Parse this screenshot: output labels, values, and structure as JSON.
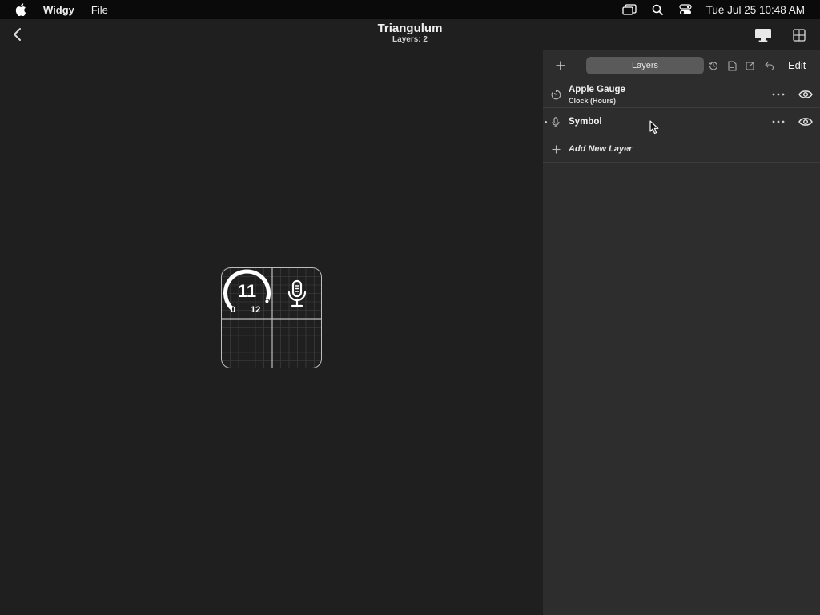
{
  "menubar": {
    "app_name": "Widgy",
    "menu_items": [
      "File"
    ],
    "clock": "Tue Jul 25  10:48 AM",
    "icons": [
      "apple-icon",
      "screen-mirroring-icon",
      "search-icon",
      "control-center-icon"
    ]
  },
  "toolbar": {
    "title": "Triangulum",
    "subtitle": "Layers: 2",
    "icons": [
      "chevron-left-icon",
      "display-icon",
      "grid-layout-icon"
    ]
  },
  "widget": {
    "gauge_value": "11",
    "gauge_min": "0",
    "gauge_max": "12",
    "gauge_fraction": 0.917,
    "symbol": "mic-icon"
  },
  "panel": {
    "tab_label": "Layers",
    "edit_label": "Edit",
    "tools": [
      "history-icon",
      "document-icon",
      "compose-icon",
      "undo-icon"
    ],
    "layers": [
      {
        "name": "Apple Gauge",
        "subtitle": "Clock (Hours)",
        "icon": "timer-icon"
      },
      {
        "name": "Symbol",
        "subtitle": "",
        "icon": "mic-icon"
      }
    ],
    "add_layer_label": "Add New Layer"
  },
  "colors": {
    "menubar_bg": "#0a0a0a",
    "canvas_bg": "#1f1f1f",
    "panel_bg": "#2d2d2d",
    "tab_bg": "#5a5a5a"
  }
}
